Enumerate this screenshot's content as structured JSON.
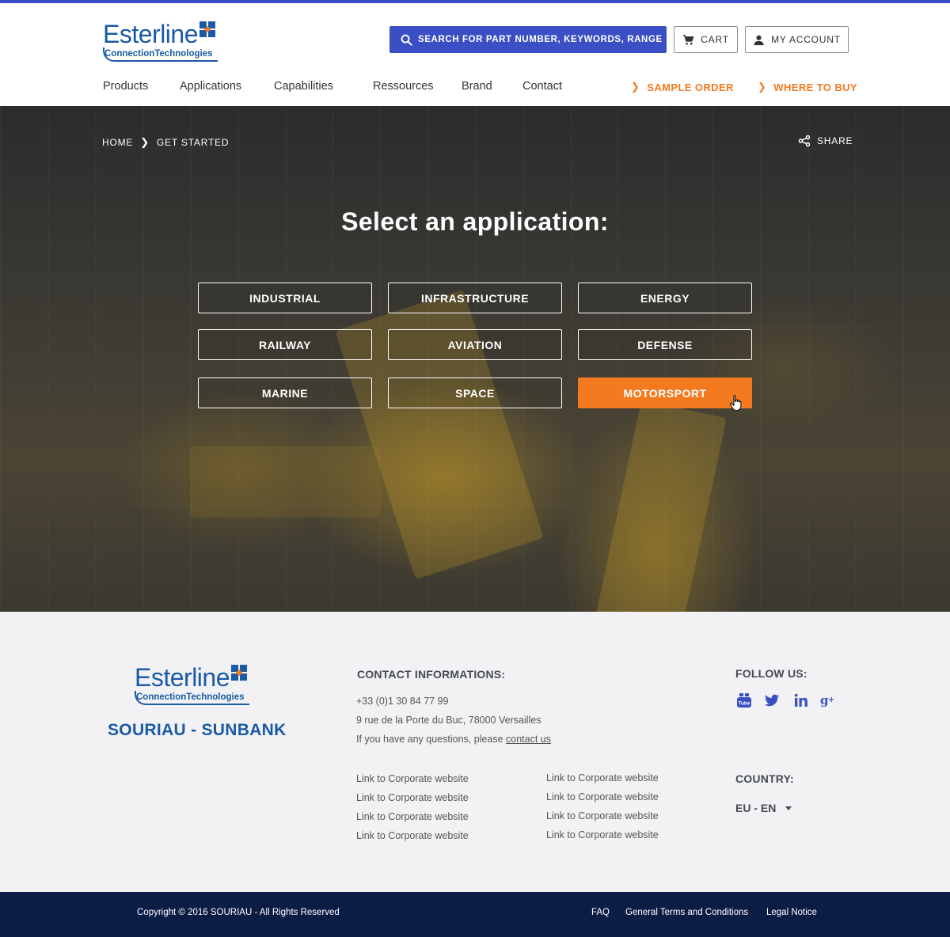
{
  "brand": {
    "logo_word": "Esterline",
    "logo_sub": "ConnectionTechnologies",
    "footer_brand": "SOURIAU - SUNBANK",
    "colors": {
      "primary": "#3b4fc4",
      "orange": "#f47a20",
      "logo_blue": "#1a5aa6",
      "navy": "#0c1d45"
    }
  },
  "header": {
    "search_label": "Search for part number, keywords, range",
    "cart_label": "Cart",
    "account_label": "My Account",
    "nav": [
      "Products",
      "Applications",
      "Capabilities",
      "Ressources",
      "Brand",
      "Contact"
    ],
    "cta": [
      "Sample order",
      "Where to buy"
    ]
  },
  "hero": {
    "breadcrumb": [
      "Home",
      "Get started"
    ],
    "share_label": "Share",
    "title": "Select an application:",
    "applications": [
      "Industrial",
      "Infrastructure",
      "Energy",
      "Railway",
      "Aviation",
      "Defense",
      "Marine",
      "Space",
      "Motorsport"
    ],
    "selected": "Motorsport"
  },
  "footer": {
    "contact_heading": "CONTACT INFORMATIONS:",
    "phone": "+33 (0)1 30 84 77 99",
    "address": "9 rue de la Porte du Buc, 78000 Versailles",
    "question_prefix": "If you have any questions, please ",
    "contact_link": "contact us",
    "links_col1": [
      "Link to Corporate website",
      "Link to Corporate website",
      "Link to Corporate website",
      "Link to Corporate website"
    ],
    "links_col2": [
      "Link to Corporate website",
      "Link to Corporate website",
      "Link to Corporate website",
      "Link to Corporate website"
    ],
    "follow_heading": "FOLLOW US:",
    "social_icons": [
      "youtube-icon",
      "twitter-icon",
      "linkedin-icon",
      "google-plus-icon"
    ],
    "country_heading": "COUNTRY:",
    "country_value": "EU - EN"
  },
  "bottom": {
    "copyright": "Copyright © 2016 SOURIAU - All Rights Reserved",
    "links": [
      "FAQ",
      "General Terms and Conditions",
      "Legal Notice"
    ]
  }
}
